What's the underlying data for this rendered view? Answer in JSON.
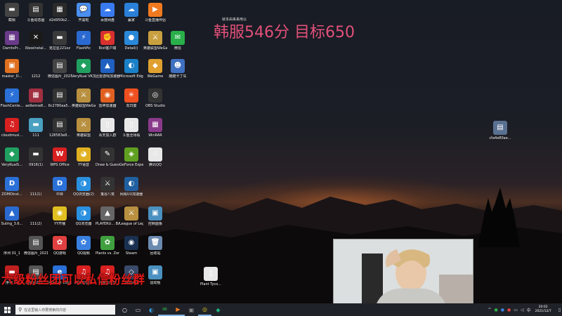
{
  "overlay": {
    "small_text": "就本由来来用以",
    "score_text": "韩服546分  目标650",
    "red_text": "六级粉丝团可以私信粉丝群"
  },
  "desktop_icons": [
    {
      "label": "截频",
      "glyph": "▬",
      "color": "#444"
    },
    {
      "label": "斗鱼动态图",
      "glyph": "▤",
      "color": "#333"
    },
    {
      "label": "d2d950b2...",
      "glyph": "▦",
      "color": "#2a2a2a"
    },
    {
      "label": "开黑啦",
      "glyph": "💬",
      "color": "#4a8ef0"
    },
    {
      "label": "百度网盘",
      "glyph": "☁",
      "color": "#3a7af0"
    },
    {
      "label": "赢家",
      "glyph": "☁",
      "color": "#2a80d8"
    },
    {
      "label": "斗鱼直播伴侣",
      "glyph": "▶",
      "color": "#f07a20"
    },
    {
      "label": "DarntsPr...",
      "glyph": "▦",
      "color": "#6a3a8a"
    },
    {
      "label": "XboxInstal...",
      "glyph": "✕",
      "color": "#1a1a1a"
    },
    {
      "label": "克拉星221oz",
      "glyph": "▬",
      "color": "#3a3a3a"
    },
    {
      "label": "FlashPic",
      "glyph": "⚡",
      "color": "#2a6ad0"
    },
    {
      "label": "Riot客户端",
      "glyph": "✊",
      "color": "#d83030"
    },
    {
      "label": "Detail()",
      "glyph": "●",
      "color": "#2a88d8"
    },
    {
      "label": "英雄联盟WeGame版",
      "glyph": "⚔",
      "color": "#c8a040"
    },
    {
      "label": "微信",
      "glyph": "✉",
      "color": "#2ab04a"
    },
    {
      "label": "master_D...",
      "glyph": "▣",
      "color": "#e07020"
    },
    {
      "label": "1212",
      "glyph": "",
      "color": "transparent"
    },
    {
      "label": "微信图片_2021117...",
      "glyph": "▤",
      "color": "#444"
    },
    {
      "label": "VeryKuai VK加速器",
      "glyph": "◆",
      "color": "#20a060"
    },
    {
      "label": "迅雷游戏加速器",
      "glyph": "▲",
      "color": "#2060c0"
    },
    {
      "label": "Microsoft Edge",
      "glyph": "◐",
      "color": "#1a80c8"
    },
    {
      "label": "WeGame",
      "glyph": "◆",
      "color": "#e0a030"
    },
    {
      "label": "酷酷卡丁车",
      "glyph": "☻",
      "color": "#4070c0"
    },
    {
      "label": "FlashCente...",
      "glyph": "⚡",
      "color": "#2a70d8"
    },
    {
      "label": "ae9emie8...",
      "glyph": "▦",
      "color": "#a03040"
    },
    {
      "label": "6c2780aa5...",
      "glyph": "▤",
      "color": "#333"
    },
    {
      "label": "英雄联盟WeGame版",
      "glyph": "⚔",
      "color": "#b89040"
    },
    {
      "label": "雷神加速器",
      "glyph": "◉",
      "color": "#e06020"
    },
    {
      "label": "向日葵",
      "glyph": "✳",
      "color": "#f05020"
    },
    {
      "label": "OBS Studio",
      "glyph": "◎",
      "color": "#333"
    },
    {
      "label": "cloudmusi...",
      "glyph": "♫",
      "color": "#d82020"
    },
    {
      "label": "111",
      "glyph": "▬",
      "color": "#4aa0c0"
    },
    {
      "label": "128583e8...",
      "glyph": "▤",
      "color": "#333"
    },
    {
      "label": "英雄联盟",
      "glyph": "⚔",
      "color": "#b89040"
    },
    {
      "label": "青天加入群",
      "glyph": "▯",
      "color": "#e8e8e8"
    },
    {
      "label": "斗鱼全场看",
      "glyph": "▯",
      "color": "#e8e8e8"
    },
    {
      "label": "WinRAR",
      "glyph": "▦",
      "color": "#8a3a8a"
    },
    {
      "label": "VeryKuaiS...",
      "glyph": "◆",
      "color": "#20a060"
    },
    {
      "label": "0916(1)",
      "glyph": "▬",
      "color": "#333"
    },
    {
      "label": "WPS Office",
      "glyph": "W",
      "color": "#d82020"
    },
    {
      "label": "YY语音",
      "glyph": "◕",
      "color": "#e0b020"
    },
    {
      "label": "Draw & Guess",
      "glyph": "✎",
      "color": "#333"
    },
    {
      "label": "GeForce Experience",
      "glyph": "◈",
      "color": "#60a020"
    },
    {
      "label": "腾讯QQ",
      "glyph": "☃",
      "color": "#e8e8e8"
    },
    {
      "label": "ZOMOlnst...",
      "glyph": "D",
      "color": "#2a70d8"
    },
    {
      "label": "111(1)",
      "glyph": "",
      "color": "transparent"
    },
    {
      "label": "中目",
      "glyph": "D",
      "color": "#2a70d8"
    },
    {
      "label": "QQ浏览器(2)",
      "glyph": "◑",
      "color": "#2a90e0"
    },
    {
      "label": "鬼谷八荒",
      "glyph": "⚔",
      "color": "#333"
    },
    {
      "label": "网易UU加速器",
      "glyph": "◐",
      "color": "#2060a0"
    },
    {
      "label": "Suiing_3.6...",
      "glyph": "▲",
      "color": "#2a6ad0"
    },
    {
      "label": "111(2)",
      "glyph": "",
      "color": "transparent"
    },
    {
      "label": "YY开播",
      "glyph": "◉",
      "color": "#e0c020"
    },
    {
      "label": "QQ浏览器",
      "glyph": "◑",
      "color": "#2a90e0"
    },
    {
      "label": "PLAYERU... BATTLEGR...",
      "glyph": "▲",
      "color": "#666"
    },
    {
      "label": "League of Legends",
      "glyph": "⚔",
      "color": "#b89040"
    },
    {
      "label": "控制面板",
      "glyph": "▣",
      "color": "#4a90c0"
    },
    {
      "label": "序列 01_1",
      "glyph": "",
      "color": "transparent"
    },
    {
      "label": "微信图片_2021102...",
      "glyph": "▤",
      "color": "#555"
    },
    {
      "label": "QQ游戏",
      "glyph": "✿",
      "color": "#e04040"
    },
    {
      "label": "QQ视频",
      "glyph": "✿",
      "color": "#3a80e0"
    },
    {
      "label": "Plants vs. Zombies G...",
      "glyph": "✿",
      "color": "#40a040"
    },
    {
      "label": "Steam",
      "glyph": "◉",
      "color": "#1a3050"
    },
    {
      "label": "回收站",
      "glyph": "🗑",
      "color": "#6a8ab0"
    },
    {
      "label": "序列 01",
      "glyph": "▬",
      "color": "#c02020"
    },
    {
      "label": "蚂蚁ai2d5...",
      "glyph": "▤",
      "color": "#555"
    },
    {
      "label": "Internet Explorer",
      "glyph": "e",
      "color": "#2a70d8"
    },
    {
      "label": "网易云音乐",
      "glyph": "♫",
      "color": "#d82020"
    },
    {
      "label": "网易云音乐",
      "glyph": "♫",
      "color": "#d82020"
    },
    {
      "label": "Wonder",
      "glyph": "◇",
      "color": "#3a4a6a"
    },
    {
      "label": "运动阻",
      "glyph": "▣",
      "color": "#4a90c0"
    },
    {
      "label": "Plant Tyco...",
      "glyph": "▯",
      "color": "#e8e8e8"
    },
    {
      "label": "cfa4e80ae...",
      "glyph": "▤",
      "color": "#5a7090"
    }
  ],
  "taskbar": {
    "search_placeholder": "在这里输入你要搜索的内容",
    "clock_time": "20:02",
    "clock_date": "2021/12/7",
    "tray_text": "^",
    "ime_text": "中"
  }
}
